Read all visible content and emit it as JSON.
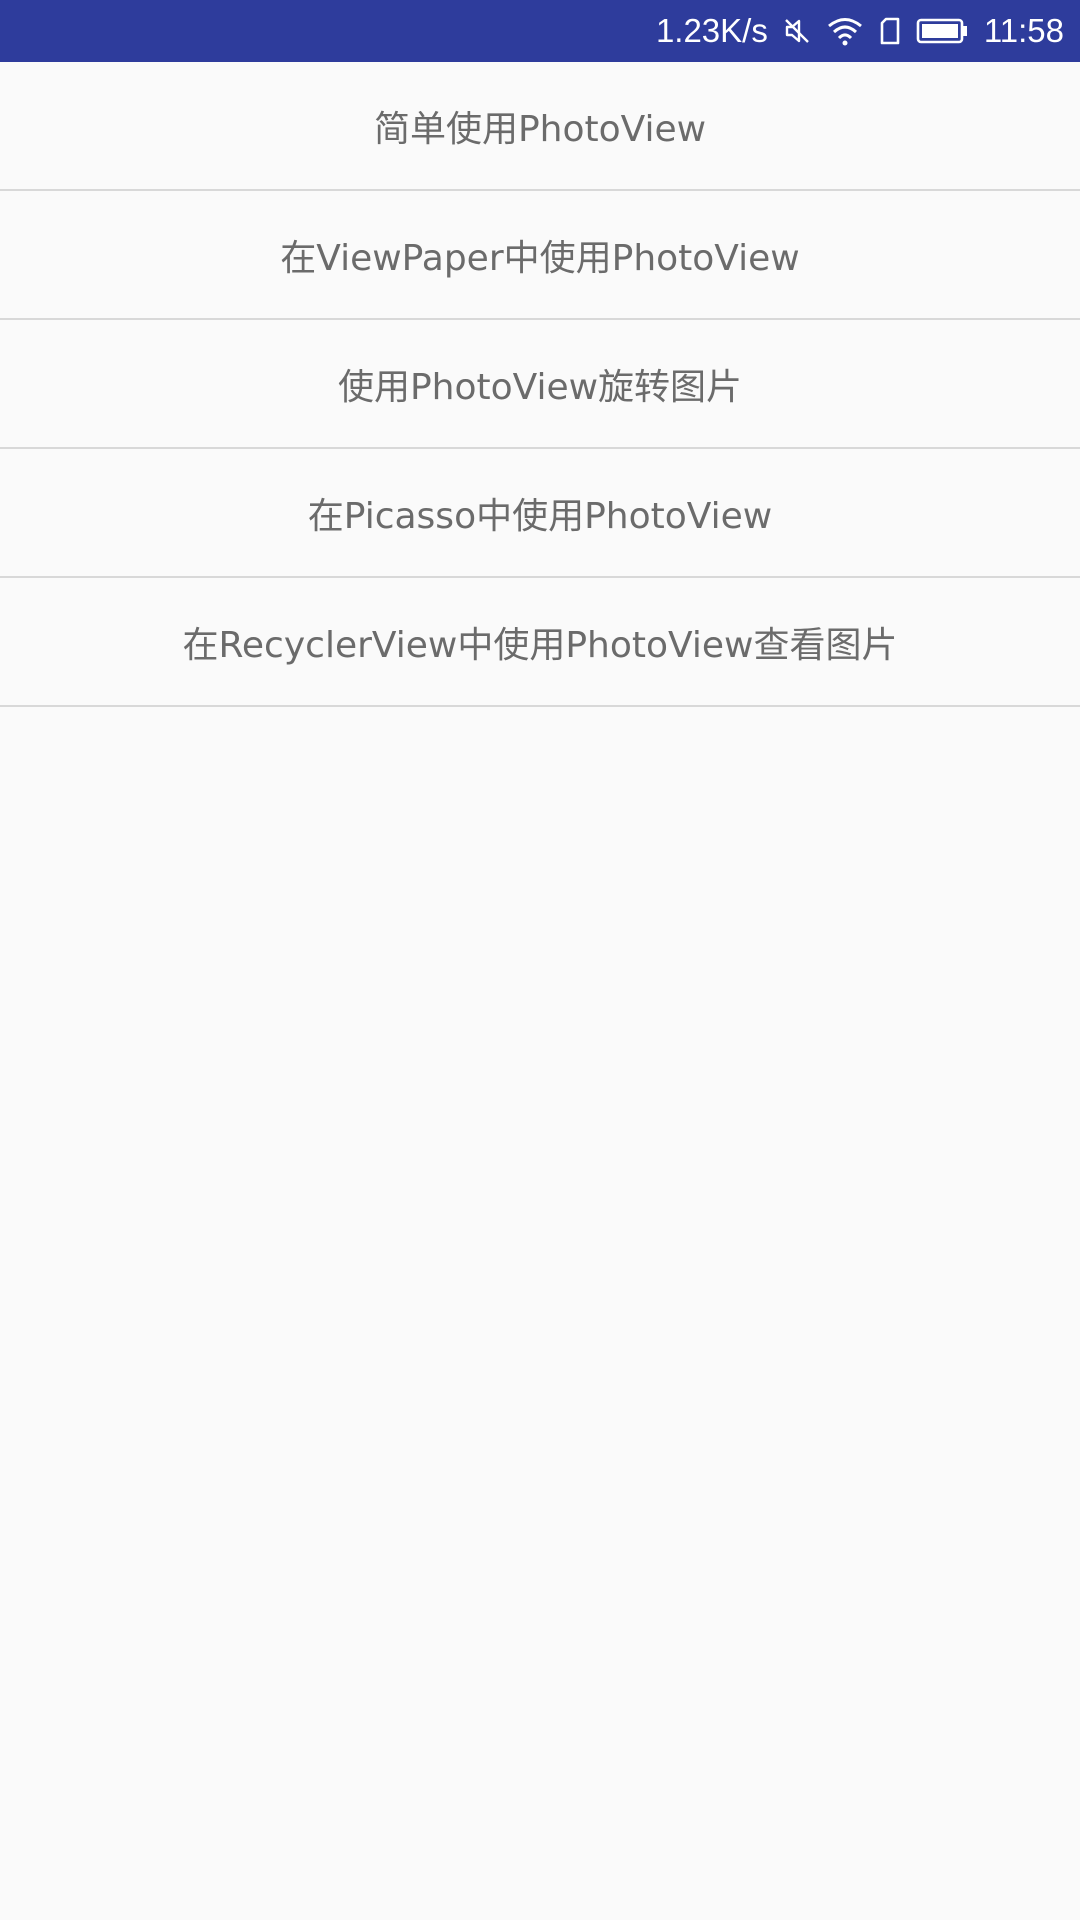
{
  "status_bar": {
    "network_speed": "1.23K/s",
    "time": "11:58",
    "icons": [
      "mute-icon",
      "wifi-icon",
      "sim-card-icon",
      "battery-icon"
    ],
    "background_color": "#2e3c9c"
  },
  "menu": {
    "items": [
      {
        "label": "简单使用PhotoView"
      },
      {
        "label": "在ViewPaper中使用PhotoView"
      },
      {
        "label": "使用PhotoView旋转图片"
      },
      {
        "label": "在Picasso中使用PhotoView"
      },
      {
        "label": "在RecyclerView中使用PhotoView查看图片"
      }
    ]
  },
  "colors": {
    "background": "#fafafa",
    "item_text": "#6b6b6b",
    "divider": "#d8d8d8"
  }
}
